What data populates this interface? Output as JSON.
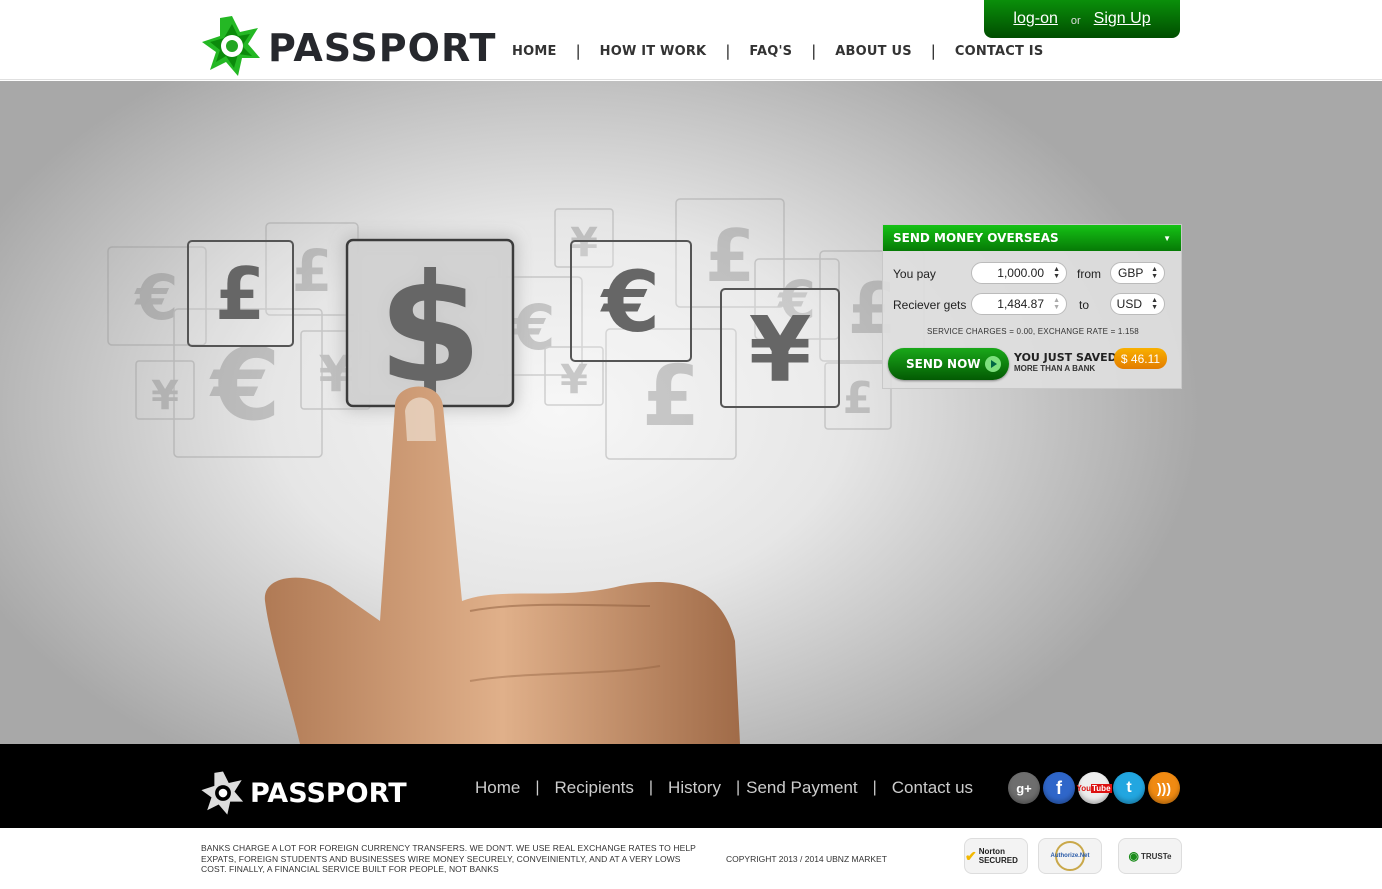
{
  "header": {
    "logo_text": "PASSPORT",
    "nav": [
      "HOME",
      "HOW IT WORK",
      "FAQ'S",
      "ABOUT US",
      "CONTACT IS"
    ],
    "login": "log-on",
    "or": "or",
    "signup": "Sign Up"
  },
  "hero": {
    "symbols": [
      "$",
      "£",
      "€",
      "¥"
    ]
  },
  "panel": {
    "title": "SEND MONEY OVERSEAS",
    "you_pay_label": "You pay",
    "you_pay_value": "1,000.00",
    "from_label": "from",
    "from_currency": "GBP",
    "receiver_label": "Reciever gets",
    "receiver_value": "1,484.87",
    "to_label": "to",
    "to_currency": "USD",
    "charges": "SERVICE CHARGES = 0.00, EXCHANGE RATE = 1.158",
    "send_button": "SEND NOW",
    "saved_line1": "YOU JUST SAVED",
    "saved_line2": "MORE THAN A BANK",
    "saved_amount": "$ 46.11"
  },
  "footer": {
    "logo_text": "PASSPORT",
    "nav": [
      "Home",
      "Recipients",
      "History",
      "Send Payment",
      "Contact us"
    ],
    "social": [
      "google-plus",
      "facebook",
      "youtube",
      "twitter",
      "rss"
    ],
    "disclaimer": "BANKS CHARGE A LOT FOR FOREIGN CURRENCY TRANSFERS. WE DON'T. WE USE REAL EXCHANGE RATES TO HELP EXPATS, FOREIGN STUDENTS AND BUSINESSES WIRE MONEY SECURELY, CONVEINIENTLY, AND AT A VERY LOWS COST. FINALLY, A FINANCIAL SERVICE BUILT FOR PEOPLE, NOT BANKS",
    "copyright": "COPYRIGHT 2013 / 2014 UBNZ MARKET",
    "seals": [
      "Norton SECURED",
      "Authorize.Net",
      "TRUSTe"
    ]
  },
  "colors": {
    "brand_green": "#0a8f0a",
    "accent_orange": "#f39a00",
    "footer_bg": "#000000"
  }
}
